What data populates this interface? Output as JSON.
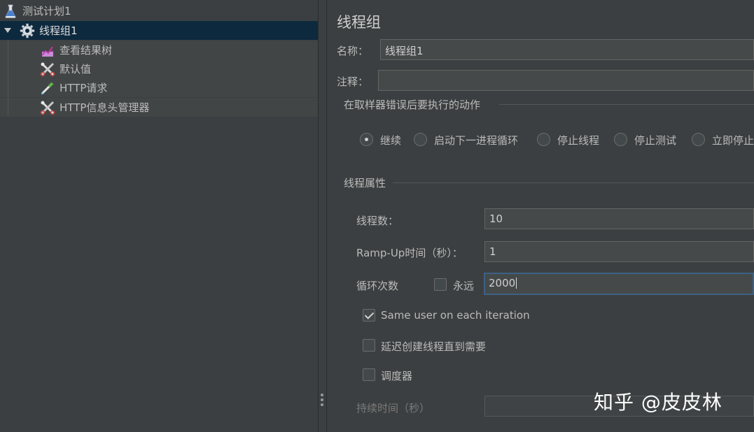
{
  "tree": {
    "test_plan": "测试计划1",
    "thread_group": "线程组1",
    "children": [
      "查看结果树",
      "默认值",
      "HTTP请求",
      "HTTP信息头管理器"
    ]
  },
  "panel": {
    "title": "线程组",
    "name_label": "名称：",
    "name_value": "线程组1",
    "comment_label": "注释：",
    "comment_value": "",
    "error_group_title": "在取样器错误后要执行的动作",
    "error_actions": [
      "继续",
      "启动下一进程循环",
      "停止线程",
      "停止测试",
      "立即停止"
    ],
    "selected_action": "继续",
    "thread_props_title": "线程属性",
    "threads_label": "线程数：",
    "threads_value": "10",
    "rampup_label": "Ramp-Up时间（秒）：",
    "rampup_value": "1",
    "loop_label": "循环次数",
    "forever_label": "永远",
    "forever_checked": false,
    "loop_value": "2000",
    "same_user_label": "Same user on each iteration",
    "same_user_checked": true,
    "delay_label": "延迟创建线程直到需要",
    "delay_checked": false,
    "scheduler_label": "调度器",
    "scheduler_checked": false,
    "duration_label": "持续时间（秒）",
    "duration_value": ""
  },
  "watermark": "知乎 @皮皮林",
  "colors": {
    "background": "#3c3f41",
    "selection": "#0d293e",
    "field": "#45494a",
    "focus_border": "#3d6185",
    "text": "#bbbbbb"
  },
  "icons": {
    "test_plan": "flask-icon",
    "thread_group": "gear-icon",
    "results_tree": "chart-icon",
    "defaults": "wrench-scissors-icon",
    "http_request": "pipette-icon",
    "header_manager": "wrench-scissors-icon"
  }
}
